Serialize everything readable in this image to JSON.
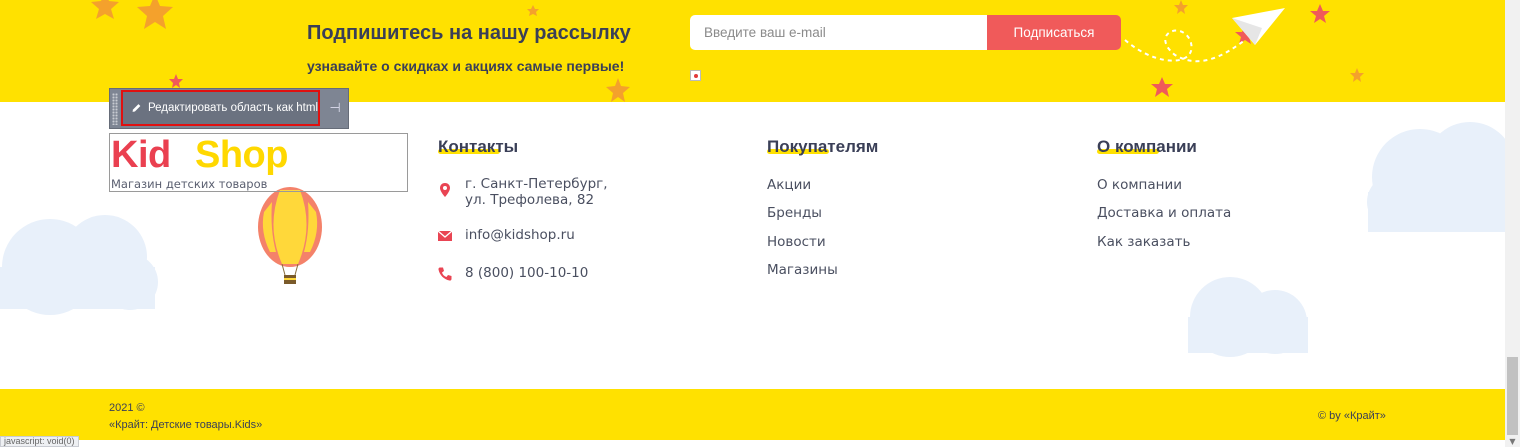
{
  "newsletter": {
    "title": "Подпишитесь на нашу рассылку",
    "subtitle": "узнавайте о скидках и акциях самые первые!",
    "email_placeholder": "Введите ваш e-mail",
    "subscribe_label": "Подписаться"
  },
  "edit_toolbar": {
    "edit_label": "Редактировать область как html",
    "pin_icon": "pin-icon"
  },
  "logo": {
    "kid": "Kid",
    "shop": "Shop",
    "tagline": "Магазин детских товаров"
  },
  "contacts": {
    "heading": "Контакты",
    "address_line1": "г. Санкт-Петербург,",
    "address_line2": "ул. Трефолева, 82",
    "email": "info@kidshop.ru",
    "phone": "8 (800) 100-10-10"
  },
  "buyers": {
    "heading": "Покупателям",
    "items": [
      "Акции",
      "Бренды",
      "Новости",
      "Магазины"
    ]
  },
  "company": {
    "heading": "О компании",
    "items": [
      "О компании",
      "Доставка и оплата",
      "Как заказать"
    ]
  },
  "footer": {
    "year": "2021 ©",
    "name": "«Крайт: Детские товары.Kids»",
    "credit": "© by «Крайт»"
  },
  "status_bar": {
    "text": "javascript: void(0)"
  },
  "colors": {
    "yellow": "#FFE100",
    "accent_red": "#F05A5A",
    "text_dark": "#3a3f57",
    "cloud": "#e8f0fa"
  }
}
